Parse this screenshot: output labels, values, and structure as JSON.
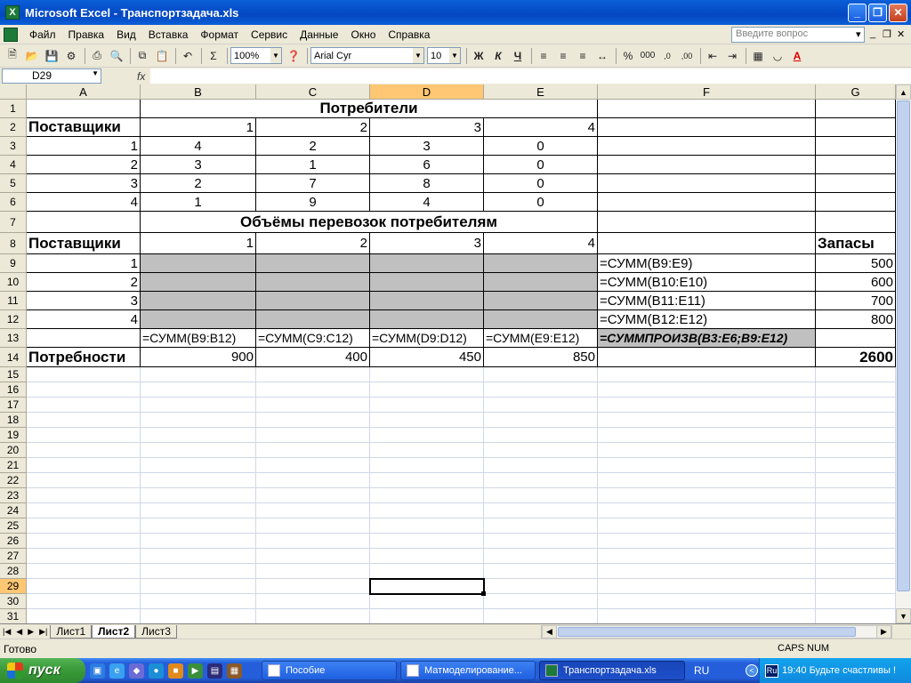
{
  "window": {
    "title": "Microsoft Excel - Транспортзадача.xls",
    "minimize": "_",
    "restore": "❐",
    "close": "✕"
  },
  "menu": {
    "items": [
      "Файл",
      "Правка",
      "Вид",
      "Вставка",
      "Формат",
      "Сервис",
      "Данные",
      "Окно",
      "Справка"
    ],
    "help_placeholder": "Введите вопрос",
    "doc_ctrls": [
      "▾",
      "_",
      "❐",
      "✕"
    ]
  },
  "toolbar": {
    "zoom": "100%",
    "font_name": "Arial Cyr",
    "font_size": "10",
    "bold": "Ж",
    "italic": "К",
    "underline": "Ч",
    "percent": "%",
    "thousands": "000",
    "autosum": "Σ",
    "increase_decimal": ",0",
    "decrease_decimal": ",00",
    "icons": [
      "new-icon",
      "open-icon",
      "save-icon",
      "permission-icon",
      "print-icon",
      "print-preview-icon",
      "copy-icon",
      "paste-icon",
      "undo-icon",
      "autosum-icon",
      "help-icon",
      "align-left-icon",
      "align-center-icon",
      "align-right-icon",
      "merge-center-icon",
      "borders-icon",
      "fill-color-icon",
      "font-color-icon"
    ]
  },
  "formula_bar": {
    "name_box": "D29",
    "fx": "fx",
    "content": ""
  },
  "columns": [
    "A",
    "B",
    "C",
    "D",
    "E",
    "F",
    "G"
  ],
  "selected_column": "D",
  "rows": [
    "1",
    "2",
    "3",
    "4",
    "5",
    "6",
    "7",
    "8",
    "9",
    "10",
    "11",
    "12",
    "13",
    "14",
    "15",
    "16",
    "17",
    "18",
    "19",
    "20",
    "21",
    "22",
    "23",
    "24",
    "25",
    "26",
    "27",
    "28",
    "29",
    "30",
    "31"
  ],
  "selected_row": "29",
  "sheet": {
    "r1": {
      "title": "Потребители"
    },
    "r2": {
      "a": "Поставщики",
      "b": "1",
      "c": "2",
      "d": "3",
      "e": "4"
    },
    "r3": {
      "a": "1",
      "b": "4",
      "c": "2",
      "d": "3",
      "e": "0"
    },
    "r4": {
      "a": "2",
      "b": "3",
      "c": "1",
      "d": "6",
      "e": "0"
    },
    "r5": {
      "a": "3",
      "b": "2",
      "c": "7",
      "d": "8",
      "e": "0"
    },
    "r6": {
      "a": "4",
      "b": "1",
      "c": "9",
      "d": "4",
      "e": "0"
    },
    "r7": {
      "title": "Объёмы перевозок потребителям"
    },
    "r8": {
      "a": "Поставщики",
      "b": "1",
      "c": "2",
      "d": "3",
      "e": "4",
      "g": "Запасы"
    },
    "r9": {
      "a": "1",
      "f": "=СУММ(B9:E9)",
      "g": "500"
    },
    "r10": {
      "a": "2",
      "f": "=СУММ(B10:E10)",
      "g": "600"
    },
    "r11": {
      "a": "3",
      "f": "=СУММ(B11:E11)",
      "g": "700"
    },
    "r12": {
      "a": "4",
      "f": "=СУММ(B12:E12)",
      "g": "800"
    },
    "r13": {
      "b": "=СУММ(B9:B12)",
      "c": "=СУММ(C9:C12)",
      "d": "=СУММ(D9:D12)",
      "e": "=СУММ(E9:E12)",
      "f": "=СУММПРОИЗВ(B3:E6;B9:E12)"
    },
    "r14": {
      "a": "Потребности",
      "b": "900",
      "c": "400",
      "d": "450",
      "e": "850",
      "g": "2600"
    }
  },
  "sheet_tabs": [
    "Лист1",
    "Лист2",
    "Лист3"
  ],
  "active_sheet": "Лист2",
  "status": {
    "ready": "Готово",
    "indicators": "CAPS NUM"
  },
  "taskbar": {
    "start": "пуск",
    "tasks": [
      "Пособие",
      "Матмоделирование...",
      "Транспортзадача.xls"
    ],
    "active_task": "Транспортзадача.xls",
    "language": "RU",
    "tray_lang": "Ru",
    "clock_text": "19:40 Будьте счастливы !"
  }
}
